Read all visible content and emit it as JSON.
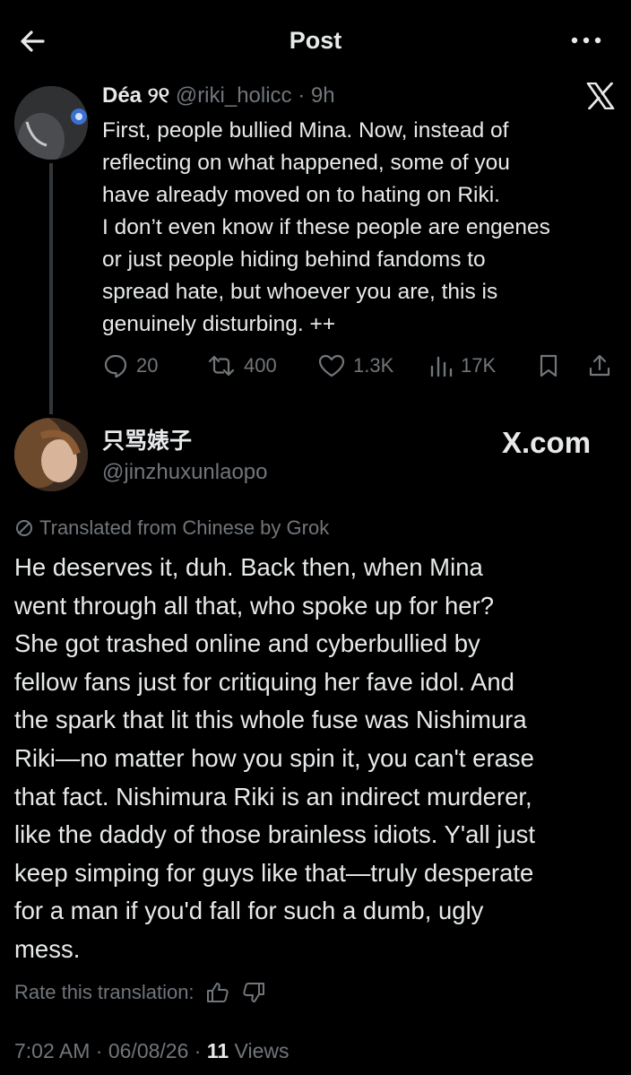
{
  "header": {
    "title": "Post"
  },
  "parent_post": {
    "display_name": "Déa ୨୧",
    "handle": "@riki_holicc",
    "age": "9h",
    "text_lines": [
      "First, people bullied Mina. Now, instead of",
      "reflecting on what happened, some of you",
      "have already moved on to hating on Riki.",
      "I don’t even know if these people are engenes",
      "or just people hiding behind fandoms to",
      "spread hate, but whoever you are, this is",
      "genuinely disturbing. ++"
    ],
    "stats": {
      "replies": "20",
      "reposts": "400",
      "likes": "1.3K",
      "views": "17K"
    }
  },
  "post": {
    "display_name": "只骂婊子",
    "handle": "@jinzhuxunlaopo",
    "watermark": "X.com",
    "translation_note": "Translated from Chinese by Grok",
    "text_lines": [
      "He deserves it, duh. Back then, when Mina",
      "went through all that, who spoke up for her?",
      "She got trashed online and cyberbullied by",
      "fellow fans just for critiquing her fave idol. And",
      "the spark that lit this whole fuse was Nishimura",
      "Riki—no matter how you spin it, you can't erase",
      "that fact. Nishimura Riki is an indirect murderer,",
      "like the daddy of those brainless idiots. Y'all just",
      "keep simping for guys like that—truly desperate",
      "for a man if you'd fall for such a dumb, ugly",
      "mess."
    ],
    "rate_label": "Rate this translation:",
    "time": "7:02 AM",
    "date": "06/08/26",
    "view_count": "11",
    "views_label": "Views"
  },
  "icons": {
    "back": "back-arrow-icon",
    "more": "more-dots-icon",
    "x_logo": "x-logo-icon",
    "reply": "reply-icon",
    "repost": "repost-icon",
    "like": "heart-icon",
    "views": "views-icon",
    "bookmark": "bookmark-icon",
    "share": "share-icon",
    "translate": "translate-icon",
    "thumbs_up": "thumbs-up-icon",
    "thumbs_down": "thumbs-down-icon"
  },
  "colors": {
    "background": "#000000",
    "primary_text": "#e7e9ea",
    "secondary_text": "#71767b",
    "thread_line": "#333639"
  }
}
